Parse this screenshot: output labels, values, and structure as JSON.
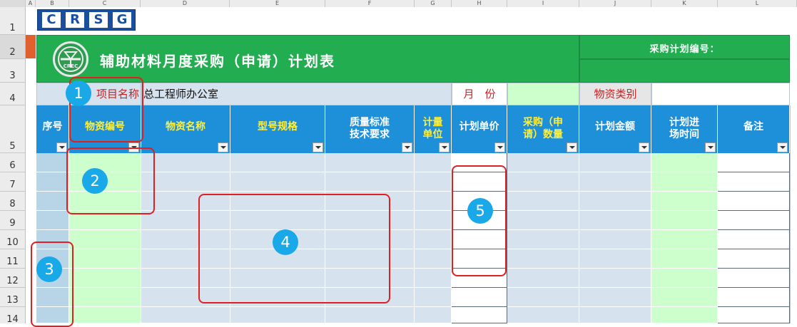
{
  "columns": [
    "A",
    "B",
    "C",
    "D",
    "E",
    "F",
    "G",
    "H",
    "I",
    "J",
    "K",
    "L"
  ],
  "rows": [
    "1",
    "2",
    "3",
    "4",
    "5",
    "6",
    "7",
    "8",
    "9",
    "10",
    "11",
    "12",
    "13",
    "14"
  ],
  "logo": {
    "letters": [
      "C",
      "R",
      "S",
      "G"
    ]
  },
  "banner": {
    "emblem": "CREC",
    "title": "辅助材料月度采购（申请）计划表",
    "plan_no_label": "采购计划编号："
  },
  "row4": {
    "project_label": "项目名称",
    "project_value": "总工程师办公室",
    "month_label": "月　份",
    "category_label": "物资类别"
  },
  "headers": [
    {
      "label": "序号",
      "yellow": false
    },
    {
      "label": "物资编号",
      "yellow": true
    },
    {
      "label": "物资名称",
      "yellow": true
    },
    {
      "label": "型号规格",
      "yellow": true
    },
    {
      "label": "质量标准\n技术要求",
      "yellow": false
    },
    {
      "label": "计量\n单位",
      "yellow": true
    },
    {
      "label": "计划单价",
      "yellow": false
    },
    {
      "label": "采购（申\n请）数量",
      "yellow": true
    },
    {
      "label": "计划金额",
      "yellow": false
    },
    {
      "label": "计划进\n场时间",
      "yellow": false
    },
    {
      "label": "备注",
      "yellow": false
    }
  ],
  "callouts": [
    "1",
    "2",
    "3",
    "4",
    "5"
  ],
  "colors": {
    "header_blue": "#1e8fd9",
    "banner_green": "#23ad51",
    "light_green": "#ccffcc",
    "light_blue": "#d6e3ef",
    "seq_blue": "#b7d5e6",
    "callout_blue": "#19a8e8",
    "highlight_red": "#e02020"
  }
}
